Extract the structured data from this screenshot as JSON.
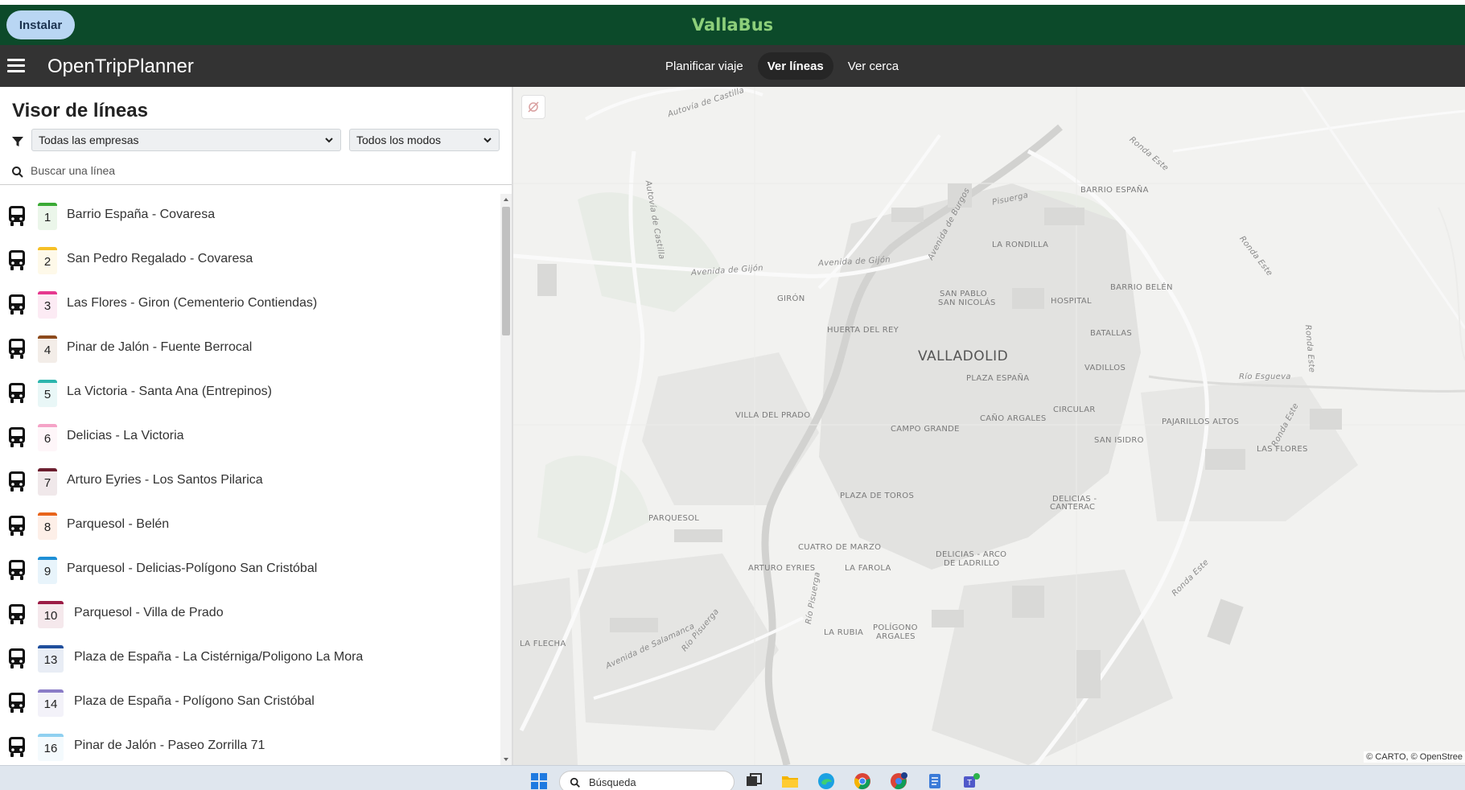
{
  "header": {
    "install_label": "Instalar",
    "brand": "VallaBus"
  },
  "nav": {
    "app_title": "OpenTripPlanner",
    "tabs": [
      {
        "label": "Planificar viaje",
        "active": false
      },
      {
        "label": "Ver líneas",
        "active": true
      },
      {
        "label": "Ver cerca",
        "active": false
      }
    ]
  },
  "sidebar": {
    "title": "Visor de líneas",
    "company_filter": "Todas las empresas",
    "mode_filter": "Todos los modos",
    "search_placeholder": "Buscar una línea",
    "routes": [
      {
        "number": "1",
        "name": "Barrio España - Covaresa",
        "color": "#3aaa35"
      },
      {
        "number": "2",
        "name": "San Pedro Regalado - Covaresa",
        "color": "#f6c026"
      },
      {
        "number": "3",
        "name": "Las Flores - Giron (Cementerio Contiendas)",
        "color": "#e6388f"
      },
      {
        "number": "4",
        "name": "Pinar de Jalón - Fuente Berrocal",
        "color": "#8c4a1c"
      },
      {
        "number": "5",
        "name": "La Victoria - Santa Ana (Entrepinos)",
        "color": "#2bb5ad"
      },
      {
        "number": "6",
        "name": "Delicias - La Victoria",
        "color": "#f5a3c7"
      },
      {
        "number": "7",
        "name": "Arturo Eyries - Los Santos Pilarica",
        "color": "#6b1d2e"
      },
      {
        "number": "8",
        "name": "Parquesol - Belén",
        "color": "#e8641b"
      },
      {
        "number": "9",
        "name": "Parquesol - Delicias-Polígono San Cristóbal",
        "color": "#1e8fd6"
      },
      {
        "number": "10",
        "name": "Parquesol - Villa de Prado",
        "color": "#9b1b45"
      },
      {
        "number": "13",
        "name": "Plaza de España - La Cistérniga/Poligono La Mora",
        "color": "#1f4e9c"
      },
      {
        "number": "14",
        "name": "Plaza de España - Polígono San Cristóbal",
        "color": "#8a7cc7"
      },
      {
        "number": "16",
        "name": "Pinar de Jalón - Paseo Zorrilla 71",
        "color": "#8fd0f0"
      }
    ]
  },
  "map": {
    "city_label": "VALLADOLID",
    "districts": [
      "BARRIO ESPAÑA",
      "LA RONDILLA",
      "SAN PABLO",
      "SAN NICOLÁS",
      "HOSPITAL",
      "BARRIO BELÉN",
      "GIRÓN",
      "HUERTA DEL REY",
      "BATALLAS",
      "VADILLOS",
      "PLAZA ESPAÑA",
      "CIRCULAR",
      "VILLA DEL PRADO",
      "CAÑO ARGALES",
      "PAJARILLOS ALTOS",
      "CAMPO GRANDE",
      "SAN ISIDRO",
      "LAS FLORES",
      "PLAZA DE TOROS",
      "DELICIAS -",
      "CANTERAC",
      "PARQUESOL",
      "CUATRO DE MARZO",
      "DELICIAS - ARCO",
      "DE LADRILLO",
      "ARTURO EYRIES",
      "LA FAROLA",
      "LA RUBIA",
      "POLÍGONO",
      "ARGALES",
      "LA FLECHA"
    ],
    "roads": [
      "Autovía de Castilla",
      "Ronda Este",
      "Autovía de Castilla",
      "Avenida de Burgos",
      "Pisuerga",
      "Avenida de Gijón",
      "Avenida de Gijón",
      "Ronda Este",
      "Ronda Este",
      "Río Esgueva",
      "Ronda Este",
      "Ronda Este",
      "Río Pisuerga",
      "Avenida de Salamanca",
      "Río Pisuerga"
    ],
    "attribution": "© CARTO, © OpenStree"
  },
  "taskbar": {
    "search_label": "Búsqueda"
  }
}
